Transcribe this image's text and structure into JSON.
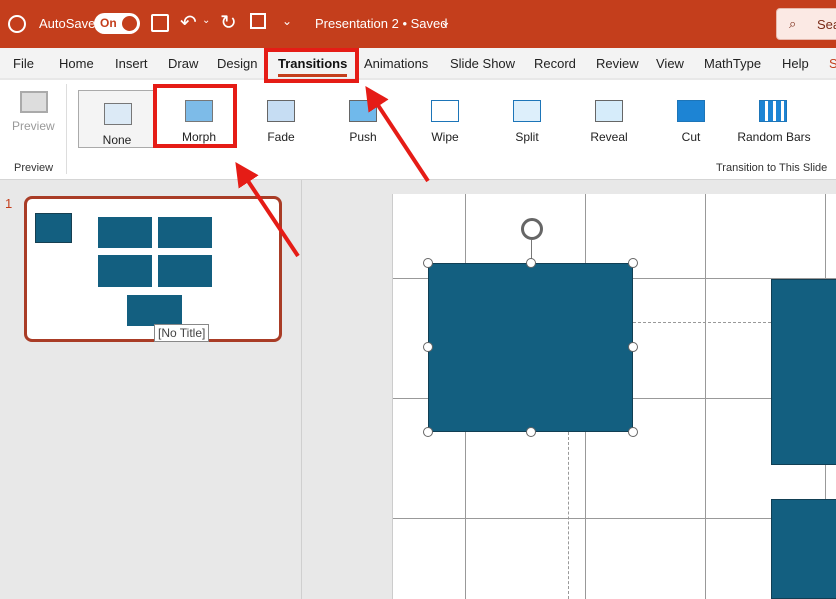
{
  "titlebar": {
    "autosave": "AutoSave",
    "toggle": "On",
    "document": "Presentation 2 • Saved",
    "search": "Sea"
  },
  "tabs": [
    "File",
    "Home",
    "Insert",
    "Draw",
    "Design",
    "Transitions",
    "Animations",
    "Slide Show",
    "Record",
    "Review",
    "View",
    "MathType",
    "Help",
    "S"
  ],
  "ribbon": {
    "preview": "Preview",
    "group_preview": "Preview",
    "group_transition": "Transition to This Slide"
  },
  "transitions": [
    "None",
    "Morph",
    "Fade",
    "Push",
    "Wipe",
    "Split",
    "Reveal",
    "Cut",
    "Random Bars"
  ],
  "slide_panel": {
    "number": "1",
    "tooltip": "[No Title]"
  },
  "colors": {
    "accent": "#c43e1c",
    "shape": "#135f80",
    "annotation": "#e51c16"
  }
}
